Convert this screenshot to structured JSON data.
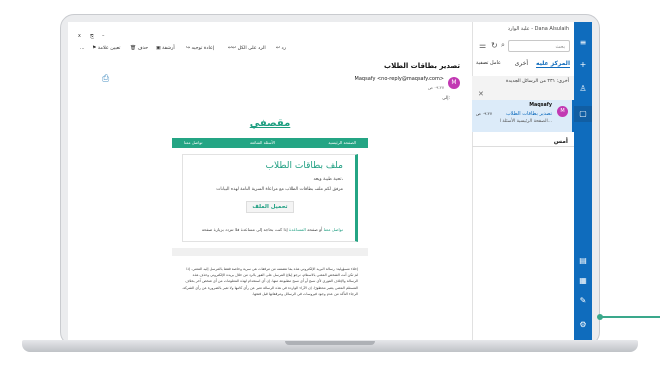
{
  "reader": {
    "toolbar": {
      "close_glyph": "x",
      "pin_glyph": "⎘",
      "minimize_glyph": "–",
      "reply": "رد",
      "reply_all": "الرد على الكل",
      "forward": "إعادة توجيه",
      "archive": "أرشفة",
      "delete": "حذف",
      "flag": "تعيين علامة",
      "more": "..."
    },
    "subject": "تصدير بطاقات الطلاب",
    "sender_initial": "M",
    "sender": "Maqsafy <no-reply@maqsafy.com>",
    "date": "٠٩:٢٧ ص",
    "to": "إلى:"
  },
  "newsletter": {
    "logo": "مقصفي",
    "nav": [
      "الصفحة الرئيسية",
      "الأسئلة الشائعة",
      "تواصل معنا"
    ],
    "card_title": "ملف بطاقات الطلاب",
    "greeting": "تحية طيبة وبعد،",
    "body": "مرفق لكم ملف بطاقات الطلاب مع مراعاة السرية التامة لهذه البيانات",
    "download_button": "تحميل الملف",
    "help_prefix": "إذا كنت بحاجة إلى مساعدة فلا تتردد بزيارة صفحة",
    "help_link1": "المساعدة",
    "help_mid": "أو صفحة",
    "help_link2": "تواصل معنا",
    "disclaimer": "إخلاء مسؤولية: رسالة البريد الإلكتروني هذه بما تتضمنه من مرفقات هي سرية وخاصة فقط بالمرسل إليه المعني. إذا لم تكن أنت الشخص المعني بالاستلام، نرجو إبلاغ المرسل على الفور بالرد من خلال بريده الإلكتروني وحذف هذه الرسالة والإتلاف الفوري لأي نسخ أو أي نسخ مطبوعة منها. إن أي استخدام لهذه المعلومات من أي شخص آخر بخلاف المستلم المعني يعتبر محظورًا. إن الآراء الواردة في هذه الرسالة تعبر عن رأي كاتبها ولا تعبر بالضرورة عن رأي الشركة. الرجاء التأكد من عدم وجود فيروسات في الرسائل ومرفقاتها قبل فتحها."
  },
  "folders": {
    "header": "علبة الوارد - Dana Alsulaih",
    "search_placeholder": "بحث",
    "tab_focused": "المركز عليه",
    "tab_other": "أخرى",
    "filter": "عامل تصفية",
    "banner": "أخرى: ٢٣١ من الرسائل الجديدة",
    "item": {
      "initial": "M",
      "sender": "Maqsafy",
      "subject": "تصدير بطاقات الطلاب",
      "time": "٠٩:٢٧ ص",
      "preview": "الصفحة الرئيسية الأسئلة ا..."
    },
    "group_label": "أمس"
  },
  "colors": {
    "brand_green": "#24a584",
    "outlook_blue": "#0f6cbd",
    "avatar": "#c239b3"
  }
}
